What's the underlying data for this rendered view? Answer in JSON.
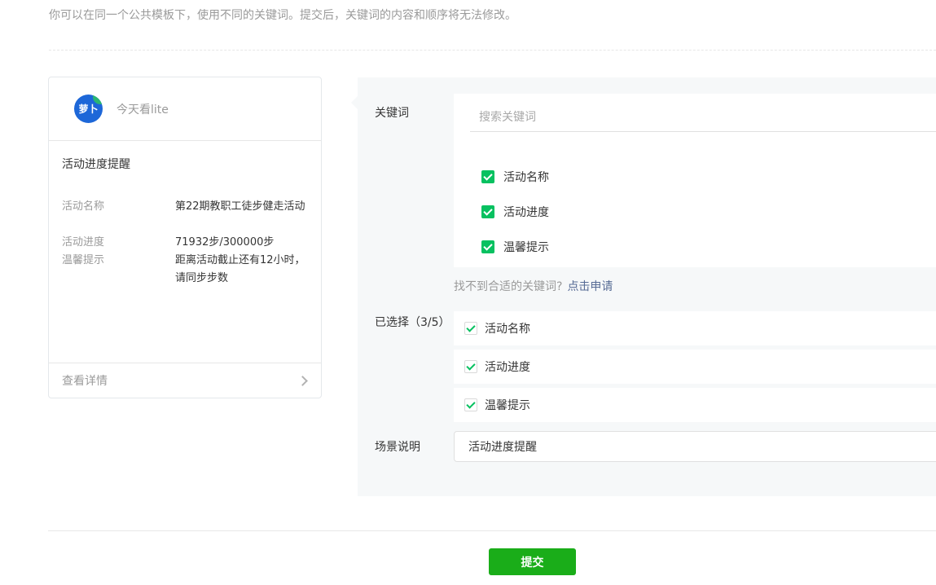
{
  "header": {
    "hint": "你可以在同一个公共模板下，使用不同的关键词。提交后，关键词的内容和顺序将无法修改。"
  },
  "preview": {
    "avatar_text": "萝卜",
    "account_name": "今天看lite",
    "title": "活动进度提醒",
    "fields": [
      {
        "label": "活动名称",
        "value": "第22期教职工徒步健走活动"
      },
      {
        "label": "活动进度",
        "value": "71932步/300000步"
      },
      {
        "label": "温馨提示",
        "value": "距离活动截止还有12小时，请同步步数"
      }
    ],
    "footer_link": "查看详情"
  },
  "editor": {
    "keywords_label": "关键词",
    "search_placeholder": "搜索关键词",
    "options": [
      "活动名称",
      "活动进度",
      "温馨提示"
    ],
    "not_found_text": "找不到合适的关键词?",
    "apply_link": "点击申请",
    "selected_label": "已选择（3/5）",
    "selected_items": [
      "活动名称",
      "活动进度",
      "温馨提示"
    ],
    "scene_label": "场景说明",
    "scene_value": "活动进度提醒"
  },
  "actions": {
    "submit_label": "提交"
  },
  "colors": {
    "accent_green": "#07c160",
    "button_green": "#1aad19",
    "link_blue": "#576b95",
    "panel_bg": "#f6f8f9"
  }
}
